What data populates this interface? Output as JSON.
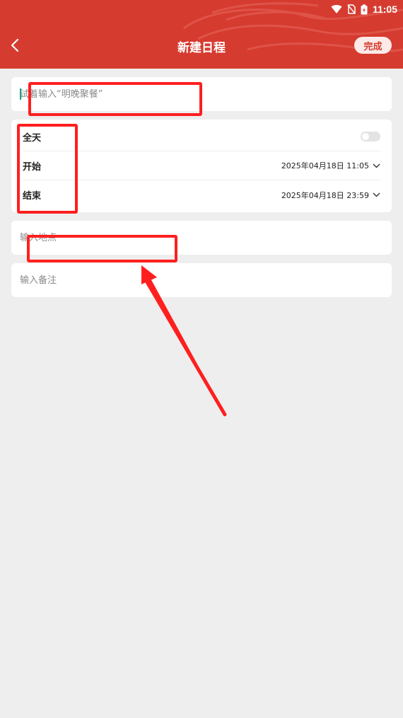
{
  "status_bar": {
    "time": "11:05",
    "icons": [
      "wifi-icon",
      "no-sim-icon",
      "battery-charging-icon"
    ]
  },
  "header": {
    "title": "新建日程",
    "back_icon": "chevron-left-icon",
    "done_label": "完成",
    "background_color": "#d63b2f"
  },
  "form": {
    "title_placeholder": "试着输入“明晚聚餐”",
    "all_day_label": "全天",
    "all_day_enabled": false,
    "start_label": "开始",
    "start_value": "2025年04月18日 11:05",
    "end_label": "结束",
    "end_value": "2025年04月18日 23:59",
    "location_placeholder": "输入地点",
    "note_placeholder": "输入备注"
  },
  "annotation_color": "#ff1f1f"
}
